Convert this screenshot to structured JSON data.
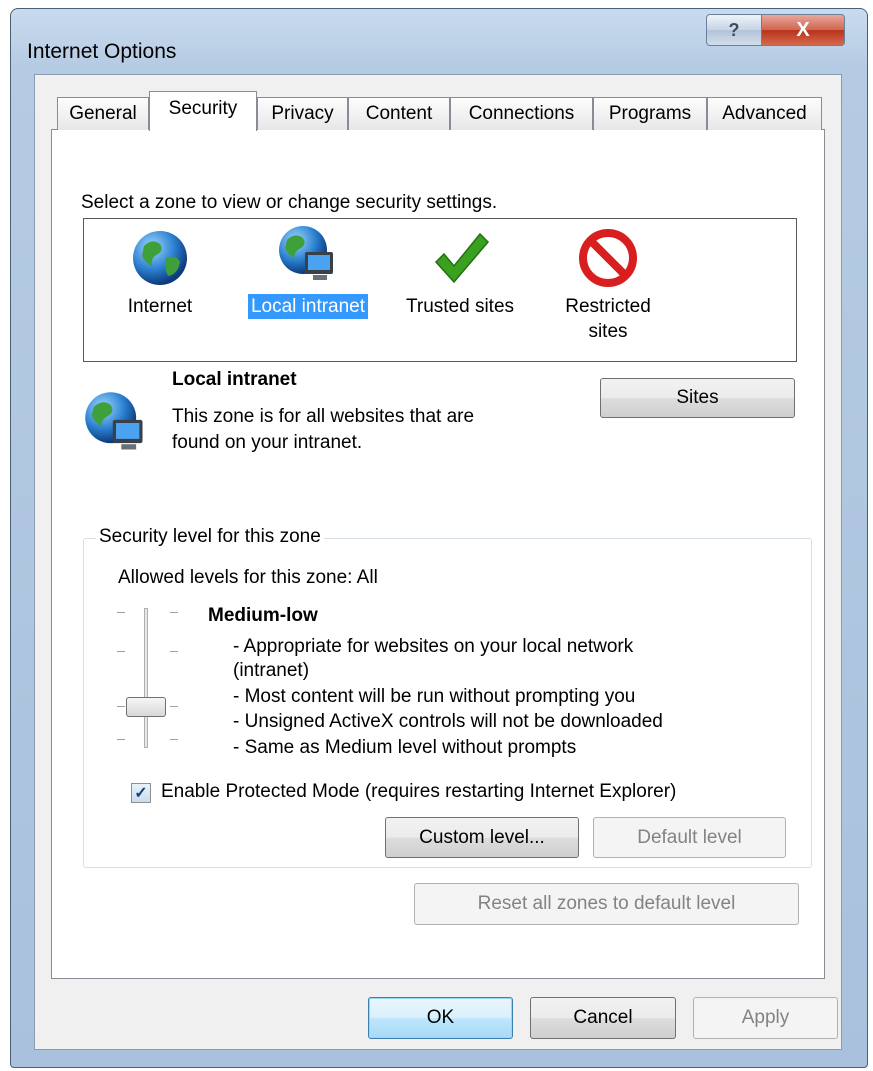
{
  "window": {
    "title": "Internet Options",
    "help_glyph": "?",
    "close_glyph": "X"
  },
  "tabs": [
    {
      "label": "General"
    },
    {
      "label": "Security"
    },
    {
      "label": "Privacy"
    },
    {
      "label": "Content"
    },
    {
      "label": "Connections"
    },
    {
      "label": "Programs"
    },
    {
      "label": "Advanced"
    }
  ],
  "zones_prompt": "Select a zone to view or change security settings.",
  "zones": [
    {
      "label": "Internet",
      "icon": "globe-icon"
    },
    {
      "label": "Local intranet",
      "icon": "globe-monitor-icon",
      "selected": true
    },
    {
      "label": "Trusted sites",
      "icon": "check-icon"
    },
    {
      "label": "Restricted",
      "label2": "sites",
      "icon": "blocked-icon"
    }
  ],
  "zone_info": {
    "name": "Local intranet",
    "desc_line1": "This zone is for all websites that are",
    "desc_line2": "found on your intranet.",
    "sites_button": "Sites"
  },
  "security_level": {
    "group_label": "Security level for this zone",
    "allowed": "Allowed levels for this zone: All",
    "level_name": "Medium-low",
    "bullets": [
      "- Appropriate for websites on your local network",
      "(intranet)",
      "- Most content will be run without prompting you",
      "- Unsigned ActiveX controls will not be downloaded",
      "- Same as Medium level without prompts"
    ],
    "protected_mode_label": "Enable Protected Mode (requires restarting Internet Explorer)",
    "protected_mode_checked": true,
    "custom_button": "Custom level...",
    "default_button": "Default level"
  },
  "reset_button": "Reset all zones to default level",
  "footer": {
    "ok": "OK",
    "cancel": "Cancel",
    "apply": "Apply"
  },
  "colors": {
    "selection": "#3399ff",
    "restricted": "#d81e1e",
    "trusted": "#3aa020",
    "titlebar": "#b5cbe3"
  }
}
